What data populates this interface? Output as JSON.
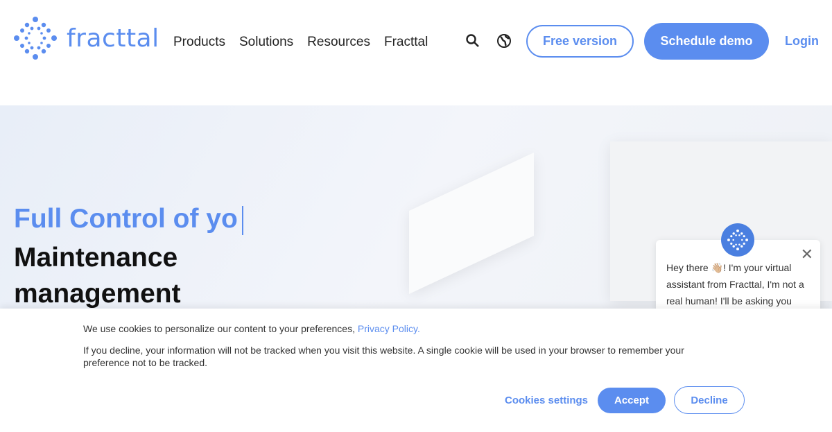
{
  "brand": {
    "name": "fracttal",
    "accent": "#5b8def"
  },
  "nav": {
    "items": [
      "Products",
      "Solutions",
      "Resources",
      "Fracttal"
    ]
  },
  "header": {
    "search_icon": "search-icon",
    "language_icon": "globe-icon",
    "free_version": "Free version",
    "schedule_demo": "Schedule demo",
    "login": "Login"
  },
  "hero": {
    "title_line1": "Full Control of yo",
    "title_line2": "Maintenance",
    "title_line3": "management"
  },
  "chat": {
    "message": "Hey there 👋🏼! I'm your virtual assistant from Fracttal, I'm not a real human! I'll be asking you",
    "close": "✕"
  },
  "cookie": {
    "text1": "We use cookies to personalize our content to your preferences, ",
    "privacy_link": "Privacy Policy.",
    "text2": "If you decline, your information will not be tracked when you visit this website. A single cookie will be used in your browser to remember your preference not to be tracked.",
    "settings": "Cookies settings",
    "accept": "Accept",
    "decline": "Decline"
  }
}
